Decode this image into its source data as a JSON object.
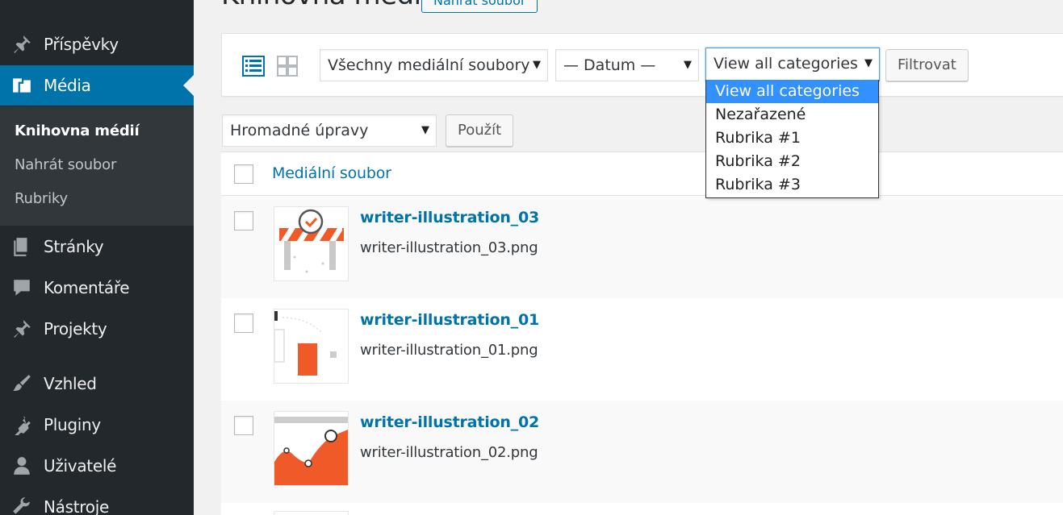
{
  "sidebar": {
    "items": [
      {
        "label": "Příspěvky",
        "icon": "pin-icon"
      },
      {
        "label": "Média",
        "icon": "media-icon"
      },
      {
        "label": "Stránky",
        "icon": "pages-icon"
      },
      {
        "label": "Komentáře",
        "icon": "comment-icon"
      },
      {
        "label": "Projekty",
        "icon": "pin-icon"
      },
      {
        "label": "Vzhled",
        "icon": "brush-icon"
      },
      {
        "label": "Pluginy",
        "icon": "plugin-icon"
      },
      {
        "label": "Uživatelé",
        "icon": "user-icon"
      },
      {
        "label": "Nástroje",
        "icon": "wrench-icon"
      }
    ],
    "submenu": [
      {
        "label": "Knihovna médií"
      },
      {
        "label": "Nahrát soubor"
      },
      {
        "label": "Rubriky"
      }
    ]
  },
  "header": {
    "title": "Knihovna médií",
    "add_new_label": "Nahrát soubor"
  },
  "toolbar": {
    "type_filter": "Všechny mediální soubory",
    "date_filter": "— Datum —",
    "category_filter": "View all categories",
    "filter_button": "Filtrovat",
    "category_options": [
      "View all categories",
      "Nezařazené",
      "Rubrika #1",
      "Rubrika #2",
      "Rubrika #3"
    ]
  },
  "bulk": {
    "select_label": "Hromadné úpravy",
    "apply_label": "Použít"
  },
  "table": {
    "column_header": "Mediální soubor",
    "rows": [
      {
        "title": "writer-illustration_03",
        "filename": "writer-illustration_03.png"
      },
      {
        "title": "writer-illustration_01",
        "filename": "writer-illustration_01.png"
      },
      {
        "title": "writer-illustration_02",
        "filename": "writer-illustration_02.png"
      }
    ]
  },
  "colors": {
    "sidebar_bg": "#23282d",
    "accent": "#0073aa",
    "option_highlight": "#3390ff",
    "illustration_orange": "#f05a28"
  }
}
